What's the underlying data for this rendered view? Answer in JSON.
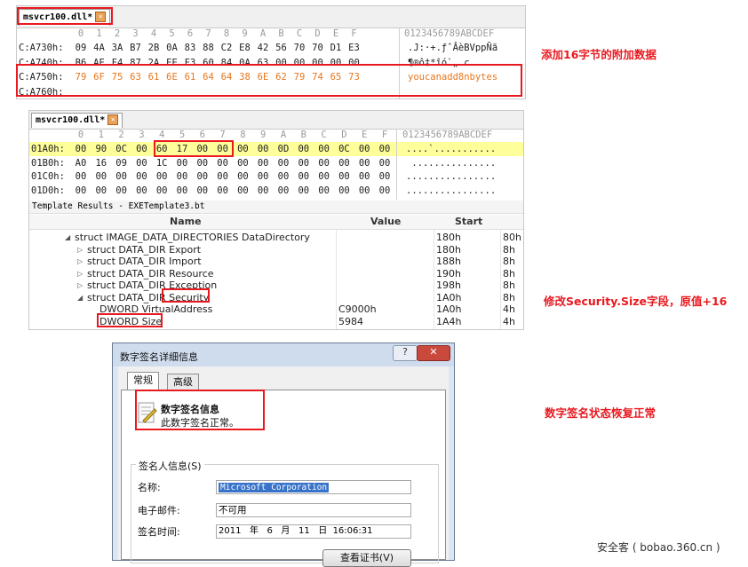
{
  "panel1": {
    "tab_label": "msvcr100.dll*",
    "ruler_hex": [
      "0",
      "1",
      "2",
      "3",
      "4",
      "5",
      "6",
      "7",
      "8",
      "9",
      "A",
      "B",
      "C",
      "D",
      "E",
      "F"
    ],
    "ruler_ascii": "0123456789ABCDEF",
    "rows": [
      {
        "addr": "C:A730h:",
        "bytes": [
          "09",
          "4A",
          "3A",
          "B7",
          "2B",
          "0A",
          "83",
          "88",
          "C2",
          "E8",
          "42",
          "56",
          "70",
          "70",
          "D1",
          "E3"
        ],
        "ascii": ".J:·+.ƒˆÂèBVppÑã",
        "highlight": false
      },
      {
        "addr": "C:A740h:",
        "bytes": [
          "B6",
          "AE",
          "F4",
          "87",
          "2A",
          "EE",
          "F3",
          "60",
          "84",
          "0A",
          "63",
          "00",
          "00",
          "00",
          "00",
          "00"
        ],
        "ascii": "¶®ô‡*îó`„.c.....",
        "highlight": false
      },
      {
        "addr": "C:A750h:",
        "bytes": [
          "79",
          "6F",
          "75",
          "63",
          "61",
          "6E",
          "61",
          "64",
          "64",
          "38",
          "6E",
          "62",
          "79",
          "74",
          "65",
          "73"
        ],
        "ascii": "youcanadd8nbytes",
        "highlight": true
      },
      {
        "addr": "C:A760h:",
        "bytes": [],
        "ascii": "",
        "highlight": false
      }
    ]
  },
  "panel2": {
    "tab_label": "msvcr100.dll*",
    "ruler_hex": [
      "0",
      "1",
      "2",
      "3",
      "4",
      "5",
      "6",
      "7",
      "8",
      "9",
      "A",
      "B",
      "C",
      "D",
      "E",
      "F"
    ],
    "ruler_ascii": "0123456789ABCDEF",
    "rows": [
      {
        "addr": "01A0h:",
        "bytes": [
          "00",
          "90",
          "0C",
          "00",
          "60",
          "17",
          "00",
          "00",
          "00",
          "00",
          "0D",
          "00",
          "00",
          "0C",
          "00",
          "00"
        ],
        "ascii": "....`..........."
      },
      {
        "addr": "01B0h:",
        "bytes": [
          "A0",
          "16",
          "09",
          "00",
          "1C",
          "00",
          "00",
          "00",
          "00",
          "00",
          "00",
          "00",
          "00",
          "00",
          "00",
          "00"
        ],
        "ascii": " ..............."
      },
      {
        "addr": "01C0h:",
        "bytes": [
          "00",
          "00",
          "00",
          "00",
          "00",
          "00",
          "00",
          "00",
          "00",
          "00",
          "00",
          "00",
          "00",
          "00",
          "00",
          "00"
        ],
        "ascii": "................"
      },
      {
        "addr": "01D0h:",
        "bytes": [
          "00",
          "00",
          "00",
          "00",
          "00",
          "00",
          "00",
          "00",
          "00",
          "00",
          "00",
          "00",
          "00",
          "00",
          "00",
          "00"
        ],
        "ascii": "................"
      }
    ],
    "template_title": "Template Results - EXETemplate3.bt",
    "columns": {
      "name": "Name",
      "value": "Value",
      "start": "Start"
    },
    "tree": [
      {
        "indent": 0,
        "arrow": "◢",
        "name": "struct IMAGE_DATA_DIRECTORIES DataDirectory",
        "value": "",
        "start": "180h",
        "size": "80h"
      },
      {
        "indent": 1,
        "arrow": "▷",
        "name": "struct DATA_DIR Export",
        "value": "",
        "start": "180h",
        "size": "8h"
      },
      {
        "indent": 1,
        "arrow": "▷",
        "name": "struct DATA_DIR Import",
        "value": "",
        "start": "188h",
        "size": "8h"
      },
      {
        "indent": 1,
        "arrow": "▷",
        "name": "struct DATA_DIR Resource",
        "value": "",
        "start": "190h",
        "size": "8h"
      },
      {
        "indent": 1,
        "arrow": "▷",
        "name": "struct DATA_DIR Exception",
        "value": "",
        "start": "198h",
        "size": "8h"
      },
      {
        "indent": 1,
        "arrow": "◢",
        "name": "struct DATA_DIR Security",
        "value": "",
        "start": "1A0h",
        "size": "8h"
      },
      {
        "indent": 2,
        "arrow": "",
        "name": "DWORD VirtualAddress",
        "value": "C9000h",
        "start": "1A0h",
        "size": "4h"
      },
      {
        "indent": 2,
        "arrow": "",
        "name": "DWORD Size",
        "value": "5984",
        "start": "1A4h",
        "size": "4h"
      }
    ]
  },
  "dialog": {
    "title": "数字签名详细信息",
    "help_btn": "?",
    "close_btn": "✕",
    "tabs": [
      "常规",
      "高级"
    ],
    "info_title": "数字签名信息",
    "info_desc": "此数字签名正常。",
    "group_title": "签名人信息(S)",
    "fields": {
      "name_label": "名称:",
      "name_value": "Microsoft Corporation",
      "email_label": "电子邮件:",
      "email_value": "不可用",
      "time_label": "签名时间:",
      "time_value": "2011   年   6   月   11   日  16:06:31"
    },
    "view_cert_btn": "查看证书(V)"
  },
  "captions": {
    "c1": "添加16字节的附加数据",
    "c2": "修改Security.Size字段，原值+16",
    "c3": "数字签名状态恢复正常",
    "watermark": "安全客 ( bobao.360.cn )"
  },
  "colors": {
    "highlight_red": "#e8191f",
    "hex_orange": "#e8751c",
    "yellow_row": "#fefe9a"
  }
}
